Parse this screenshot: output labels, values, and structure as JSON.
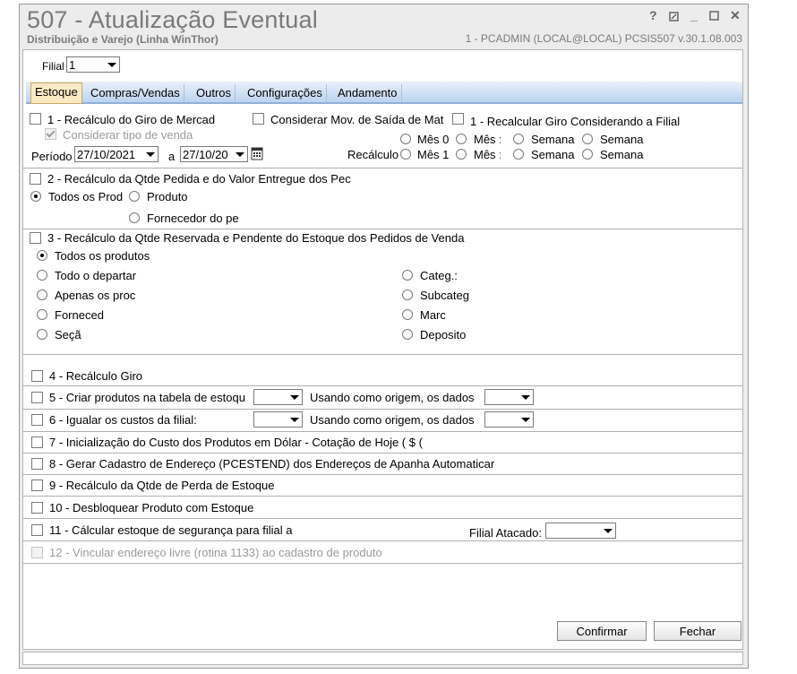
{
  "window": {
    "title": "507 - Atualização Eventual",
    "subtitle": "Distribuição e Varejo (Linha WinThor)",
    "userinfo": "1 - PCADMIN (LOCAL@LOCAL)   PCSIS507  v.30.1.08.003",
    "help_glyph": "?",
    "minimize_glyph": "_",
    "close_glyph": "✕"
  },
  "filial": {
    "label": "Filial",
    "value": "1"
  },
  "tabs": [
    "Estoque",
    "Compras/Vendas",
    "Outros",
    "Configurações",
    "Andamento"
  ],
  "sec1": {
    "label": "1 - Recálculo do Giro de Mercad",
    "considerar_mov": "Considerar Mov. de Saída de Mat",
    "recalc_filial": "1 - Recalcular Giro Considerando a Filial",
    "considerar_tipo": "Considerar tipo de venda",
    "periodo_label": "Período",
    "date_from": "27/10/2021",
    "a_label": "a",
    "date_to": "27/10/20",
    "recalculo_label": "Recálculo",
    "row1": [
      "Mês 0",
      "Mês :",
      "Semana",
      "Semana"
    ],
    "row2": [
      "Mês 1",
      "Mês :",
      "Semana",
      "Semana"
    ]
  },
  "sec2": {
    "label": "2 - Recálculo da Qtde Pedida e do Valor Entregue dos Pec",
    "todos": "Todos os Prod",
    "produto": "Produto",
    "fornecedor": "Fornecedor do pe"
  },
  "sec3": {
    "label": "3 - Recálculo da Qtde Reservada e Pendente do Estoque dos Pedidos de Venda",
    "left": [
      "Todos os produtos",
      "Todo o departar",
      "Apenas os proc",
      "Forneced",
      "Seçã"
    ],
    "right": [
      "Categ.:",
      "Subcateg",
      "Marc",
      "Deposito"
    ]
  },
  "items": {
    "i4": "4 - Recálculo Giro",
    "i5": "5 - Criar produtos na tabela de estoqu",
    "i5_origem": "Usando como origem, os dados",
    "i6": "6 - Igualar os custos da filial:",
    "i6_origem": "Usando como origem, os dados",
    "i7": "7 - Inicialização do Custo dos Produtos em Dólar - Cotação de Hoje ( $ (",
    "i8": "8 - Gerar Cadastro de Endereço (PCESTEND) dos Endereços de Apanha Automaticar",
    "i9": "9 - Recálculo da Qtde de Perda de Estoque",
    "i10": "10 - Desbloquear Produto com Estoque",
    "i11": "11 - Cálcular estoque de segurança para filial a",
    "filial_atacado": "Filial Atacado:",
    "i12": "12 - Vincular endereço livre (rotina 1133) ao cadastro de produto"
  },
  "buttons": {
    "confirmar": "Confirmar",
    "fechar": "Fechar"
  },
  "colors": {
    "tab_active": "#fbe9c4",
    "tab_bar": "#bcd3ef",
    "disabled_text": "#9a9a9a"
  }
}
